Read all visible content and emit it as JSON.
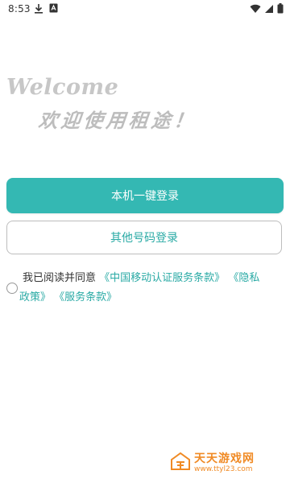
{
  "status_bar": {
    "time": "8:53",
    "icons": [
      "download-icon",
      "notification-icon",
      "wifi-icon",
      "cellular-icon",
      "battery-icon"
    ]
  },
  "welcome": {
    "title": "Welcome",
    "subtitle": "欢迎使用租途！"
  },
  "buttons": {
    "one_click_login": "本机一键登录",
    "other_number_login": "其他号码登录"
  },
  "agreement": {
    "prefix": "我已阅读并同意",
    "link_cmcc": "《中国移动认证服务条款》",
    "link_privacy_part1": "《隐私",
    "link_privacy_part2": "政策》",
    "link_service": "《服务条款》"
  },
  "watermark": {
    "title": "天天游戏网",
    "url": "www.ttyl23.com"
  },
  "colors": {
    "primary": "#34b8b3",
    "link": "#2aaaa5",
    "watermark": "#f08a24"
  }
}
